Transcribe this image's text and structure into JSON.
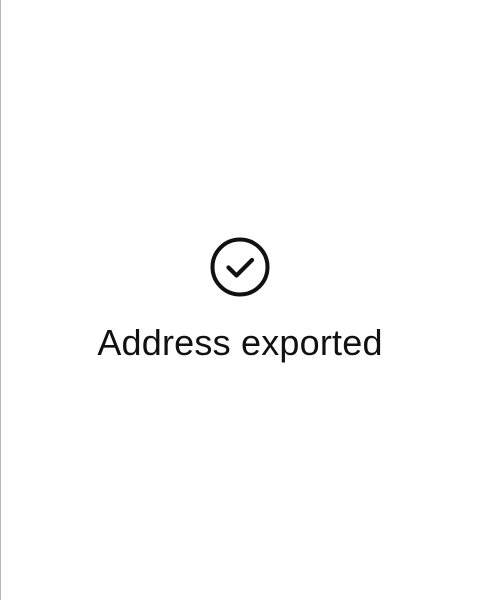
{
  "confirmation": {
    "icon": "check-circle-icon",
    "message": "Address exported"
  },
  "colors": {
    "background": "#ffffff",
    "foreground": "#111111",
    "edge": "#b8b8b8"
  }
}
